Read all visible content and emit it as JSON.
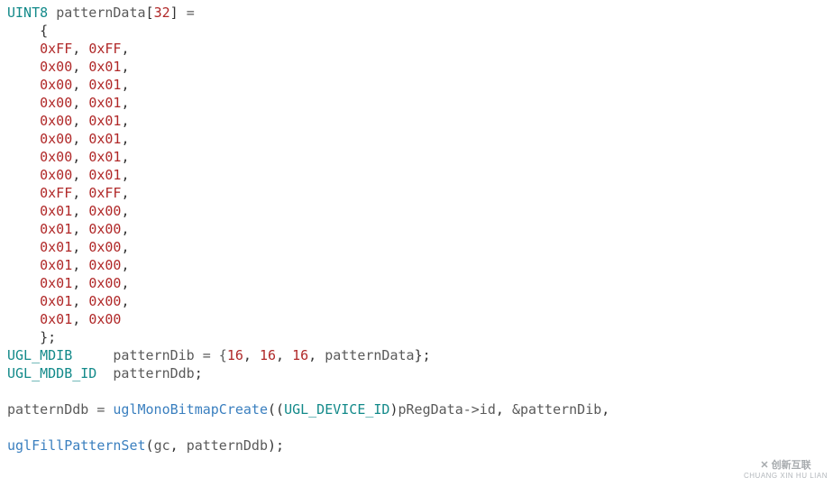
{
  "code": {
    "decl_type": "UINT8",
    "decl_name": "patternData",
    "decl_size": "32",
    "eq": "=",
    "open_brace": "{",
    "close_brace": "};",
    "rows": [
      [
        "0xFF",
        "0xFF"
      ],
      [
        "0x00",
        "0x01"
      ],
      [
        "0x00",
        "0x01"
      ],
      [
        "0x00",
        "0x01"
      ],
      [
        "0x00",
        "0x01"
      ],
      [
        "0x00",
        "0x01"
      ],
      [
        "0x00",
        "0x01"
      ],
      [
        "0x00",
        "0x01"
      ],
      [
        "0xFF",
        "0xFF"
      ],
      [
        "0x01",
        "0x00"
      ],
      [
        "0x01",
        "0x00"
      ],
      [
        "0x01",
        "0x00"
      ],
      [
        "0x01",
        "0x00"
      ],
      [
        "0x01",
        "0x00"
      ],
      [
        "0x01",
        "0x00"
      ],
      [
        "0x01",
        "0x00"
      ]
    ],
    "mdib_type": "UGL_MDIB",
    "mdib_name": "patternDib",
    "mdib_init_open": "= {",
    "mdib_vals": [
      "16",
      "16",
      "16"
    ],
    "mdib_ref": "patternData",
    "mdib_close": "};",
    "mddb_type": "UGL_MDDB_ID",
    "mddb_name": "patternDdb",
    "semicolon": ";",
    "assign_lhs": "patternDdb",
    "assign_eq": "=",
    "func1": "uglMonoBitmapCreate",
    "cast_type": "UGL_DEVICE_ID",
    "cast_expr": "pRegData->id",
    "arg2": "&patternDib",
    "trailing_comma": ",",
    "func2": "uglFillPatternSet",
    "f2_arg1": "gc",
    "f2_arg2": "patternDdb",
    "paren_close_semi": ");",
    "paren_open": "(",
    "paren_open2": "((",
    "paren_close": ")",
    "comma_sp": ", ",
    "bracket_open": "[",
    "bracket_close": "]"
  },
  "watermark": {
    "brand": "创新互联",
    "sub": "CHUANG XIN HU LIAN"
  }
}
